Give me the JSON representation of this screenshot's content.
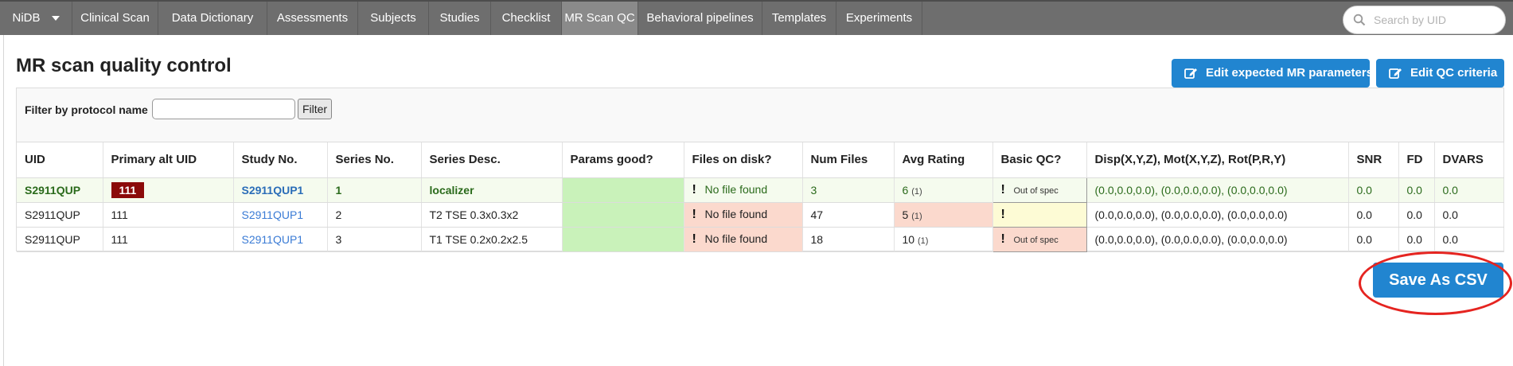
{
  "navbar": {
    "items": [
      {
        "label": "NiDB",
        "has_caret": true
      },
      {
        "label": "Clinical Scan"
      },
      {
        "label": "Data Dictionary"
      },
      {
        "label": "Assessments"
      },
      {
        "label": "Subjects"
      },
      {
        "label": "Studies"
      },
      {
        "label": "Checklist"
      },
      {
        "label": "MR Scan QC",
        "active": true
      },
      {
        "label": "Behavioral pipelines"
      },
      {
        "label": "Templates"
      },
      {
        "label": "Experiments"
      }
    ],
    "search": {
      "placeholder": "Search by UID",
      "icon": "search-icon"
    }
  },
  "page": {
    "title": "MR scan quality control",
    "buttons": {
      "edit_params": "Edit expected MR parameters",
      "edit_qc": "Edit QC criteria",
      "save_csv": "Save As CSV"
    },
    "filter": {
      "label": "Filter by protocol name",
      "value": "",
      "button": "Filter"
    }
  },
  "table": {
    "headers": [
      "UID",
      "Primary alt UID",
      "Study No.",
      "Series No.",
      "Series Desc.",
      "Params good?",
      "Files on disk?",
      "Num Files",
      "Avg Rating",
      "Basic QC?",
      "Disp(X,Y,Z), Mot(X,Y,Z), Rot(P,R,Y)",
      "SNR",
      "FD",
      "DVARS"
    ],
    "rows": [
      {
        "uid": "S2911QUP",
        "alt_uid": "111",
        "study": "S2911QUP1",
        "series_no": "1",
        "series_desc": "localizer",
        "params": "",
        "files": "No file found",
        "num_files": "3",
        "rating": "6",
        "rating_count": "(1)",
        "qc": "Out of spec",
        "motion": "(0.0,0.0,0.0), (0.0,0.0,0.0), (0.0,0.0,0.0)",
        "snr": "0.0",
        "fd": "0.0",
        "dvars": "0.0"
      },
      {
        "uid": "S2911QUP",
        "alt_uid": "111",
        "study": "S2911QUP1",
        "series_no": "2",
        "series_desc": "T2 TSE 0.3x0.3x2",
        "params": "",
        "files": "No file found",
        "num_files": "47",
        "rating": "5",
        "rating_count": "(1)",
        "qc": "",
        "motion": "(0.0,0.0,0.0), (0.0,0.0,0.0), (0.0,0.0,0.0)",
        "snr": "0.0",
        "fd": "0.0",
        "dvars": "0.0"
      },
      {
        "uid": "S2911QUP",
        "alt_uid": "111",
        "study": "S2911QUP1",
        "series_no": "3",
        "series_desc": "T1 TSE 0.2x0.2x2.5",
        "params": "",
        "files": "No file found",
        "num_files": "18",
        "rating": "10",
        "rating_count": "(1)",
        "qc": "Out of spec",
        "motion": "(0.0,0.0,0.0), (0.0,0.0,0.0), (0.0,0.0,0.0)",
        "snr": "0.0",
        "fd": "0.0",
        "dvars": "0.0"
      }
    ]
  },
  "colors": {
    "accent": "#2185d0",
    "navbar": "#6e6e6e",
    "alt_badge": "#8b0a0a",
    "params_good": "#c9f2ba",
    "warn_red": "#fbd9cd",
    "warn_yellow": "#fdfbd5",
    "highlight_circle": "#e52420"
  }
}
